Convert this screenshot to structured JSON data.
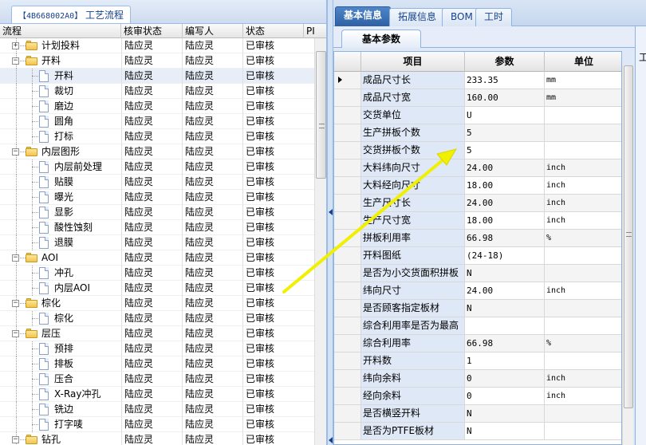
{
  "left_panel": {
    "tab": {
      "code": "【4B668002A0】",
      "name": "工艺流程"
    },
    "columns": [
      "流程",
      "核审状态",
      "编写人",
      "状态",
      "PI"
    ],
    "rows": [
      {
        "label": "计划投料",
        "level": 1,
        "kind": "folder",
        "status": "陆应灵",
        "writer": "陆应灵",
        "state": "已审核"
      },
      {
        "label": "开料",
        "level": 1,
        "kind": "folder",
        "status": "陆应灵",
        "writer": "陆应灵",
        "state": "已审核"
      },
      {
        "label": "开料",
        "level": 2,
        "kind": "doc",
        "status": "陆应灵",
        "writer": "陆应灵",
        "state": "已审核",
        "selected": true
      },
      {
        "label": "裁切",
        "level": 2,
        "kind": "doc",
        "status": "陆应灵",
        "writer": "陆应灵",
        "state": "已审核"
      },
      {
        "label": "磨边",
        "level": 2,
        "kind": "doc",
        "status": "陆应灵",
        "writer": "陆应灵",
        "state": "已审核"
      },
      {
        "label": "圆角",
        "level": 2,
        "kind": "doc",
        "status": "陆应灵",
        "writer": "陆应灵",
        "state": "已审核"
      },
      {
        "label": "打标",
        "level": 2,
        "kind": "doc",
        "status": "陆应灵",
        "writer": "陆应灵",
        "state": "已审核"
      },
      {
        "label": "内层图形",
        "level": 1,
        "kind": "folder",
        "status": "陆应灵",
        "writer": "陆应灵",
        "state": "已审核"
      },
      {
        "label": "内层前处理",
        "level": 2,
        "kind": "doc",
        "status": "陆应灵",
        "writer": "陆应灵",
        "state": "已审核"
      },
      {
        "label": "贴膜",
        "level": 2,
        "kind": "doc",
        "status": "陆应灵",
        "writer": "陆应灵",
        "state": "已审核"
      },
      {
        "label": "曝光",
        "level": 2,
        "kind": "doc",
        "status": "陆应灵",
        "writer": "陆应灵",
        "state": "已审核"
      },
      {
        "label": "显影",
        "level": 2,
        "kind": "doc",
        "status": "陆应灵",
        "writer": "陆应灵",
        "state": "已审核"
      },
      {
        "label": "酸性蚀刻",
        "level": 2,
        "kind": "doc",
        "status": "陆应灵",
        "writer": "陆应灵",
        "state": "已审核"
      },
      {
        "label": "退膜",
        "level": 2,
        "kind": "doc",
        "status": "陆应灵",
        "writer": "陆应灵",
        "state": "已审核"
      },
      {
        "label": "AOI",
        "level": 1,
        "kind": "folder",
        "status": "陆应灵",
        "writer": "陆应灵",
        "state": "已审核"
      },
      {
        "label": "冲孔",
        "level": 2,
        "kind": "doc",
        "status": "陆应灵",
        "writer": "陆应灵",
        "state": "已审核"
      },
      {
        "label": "内层AOI",
        "level": 2,
        "kind": "doc",
        "status": "陆应灵",
        "writer": "陆应灵",
        "state": "已审核"
      },
      {
        "label": "棕化",
        "level": 1,
        "kind": "folder",
        "status": "陆应灵",
        "writer": "陆应灵",
        "state": "已审核"
      },
      {
        "label": "棕化",
        "level": 2,
        "kind": "doc",
        "status": "陆应灵",
        "writer": "陆应灵",
        "state": "已审核"
      },
      {
        "label": "层压",
        "level": 1,
        "kind": "folder",
        "status": "陆应灵",
        "writer": "陆应灵",
        "state": "已审核"
      },
      {
        "label": "预排",
        "level": 2,
        "kind": "doc",
        "status": "陆应灵",
        "writer": "陆应灵",
        "state": "已审核"
      },
      {
        "label": "排板",
        "level": 2,
        "kind": "doc",
        "status": "陆应灵",
        "writer": "陆应灵",
        "state": "已审核"
      },
      {
        "label": "压合",
        "level": 2,
        "kind": "doc",
        "status": "陆应灵",
        "writer": "陆应灵",
        "state": "已审核"
      },
      {
        "label": "X-Ray冲孔",
        "level": 2,
        "kind": "doc",
        "status": "陆应灵",
        "writer": "陆应灵",
        "state": "已审核"
      },
      {
        "label": "铣边",
        "level": 2,
        "kind": "doc",
        "status": "陆应灵",
        "writer": "陆应灵",
        "state": "已审核"
      },
      {
        "label": "打字唛",
        "level": 2,
        "kind": "doc",
        "status": "陆应灵",
        "writer": "陆应灵",
        "state": "已审核"
      },
      {
        "label": "钻孔",
        "level": 1,
        "kind": "folder",
        "status": "陆应灵",
        "writer": "陆应灵",
        "state": "已审核"
      }
    ]
  },
  "right_panel": {
    "tabs": [
      "基本信息",
      "拓展信息",
      "BOM",
      "工时"
    ],
    "active_tab": 0,
    "sub_tab": "基本参数",
    "edge_tab": "工",
    "grid": {
      "columns": [
        "项目",
        "参数",
        "单位"
      ],
      "rows": [
        {
          "item": "成品尺寸长",
          "param": "233.35",
          "unit": "mm",
          "current": true
        },
        {
          "item": "成品尺寸宽",
          "param": "160.00",
          "unit": "mm"
        },
        {
          "item": "交货单位",
          "param": "U",
          "unit": ""
        },
        {
          "item": "生产拼板个数",
          "param": "5",
          "unit": ""
        },
        {
          "item": "交货拼板个数",
          "param": "5",
          "unit": ""
        },
        {
          "item": "大料纬向尺寸",
          "param": "24.00",
          "unit": "inch"
        },
        {
          "item": "大料经向尺寸",
          "param": "18.00",
          "unit": "inch"
        },
        {
          "item": "生产尺寸长",
          "param": "24.00",
          "unit": "inch"
        },
        {
          "item": "生产尺寸宽",
          "param": "18.00",
          "unit": "inch"
        },
        {
          "item": "拼板利用率",
          "param": "66.98",
          "unit": "%"
        },
        {
          "item": "开料图纸",
          "param": "(24-18)",
          "unit": ""
        },
        {
          "item": "是否为小交货面积拼板",
          "param": "N",
          "unit": ""
        },
        {
          "item": "纬向尺寸",
          "param": "24.00",
          "unit": "inch"
        },
        {
          "item": "是否顾客指定板材",
          "param": "N",
          "unit": ""
        },
        {
          "item": "综合利用率是否为最高",
          "param": "",
          "unit": ""
        },
        {
          "item": "综合利用率",
          "param": "66.98",
          "unit": "%"
        },
        {
          "item": "开料数",
          "param": "1",
          "unit": ""
        },
        {
          "item": "纬向余料",
          "param": "0",
          "unit": "inch"
        },
        {
          "item": "经向余料",
          "param": "0",
          "unit": "inch"
        },
        {
          "item": "是否横竖开料",
          "param": "N",
          "unit": ""
        },
        {
          "item": "是否为PTFE板材",
          "param": "N",
          "unit": ""
        }
      ]
    }
  },
  "colors": {
    "annotation_arrow": "#f0f000",
    "active_tab": "#2c5fa3",
    "item_cell_bg": "#dfe8f6"
  }
}
